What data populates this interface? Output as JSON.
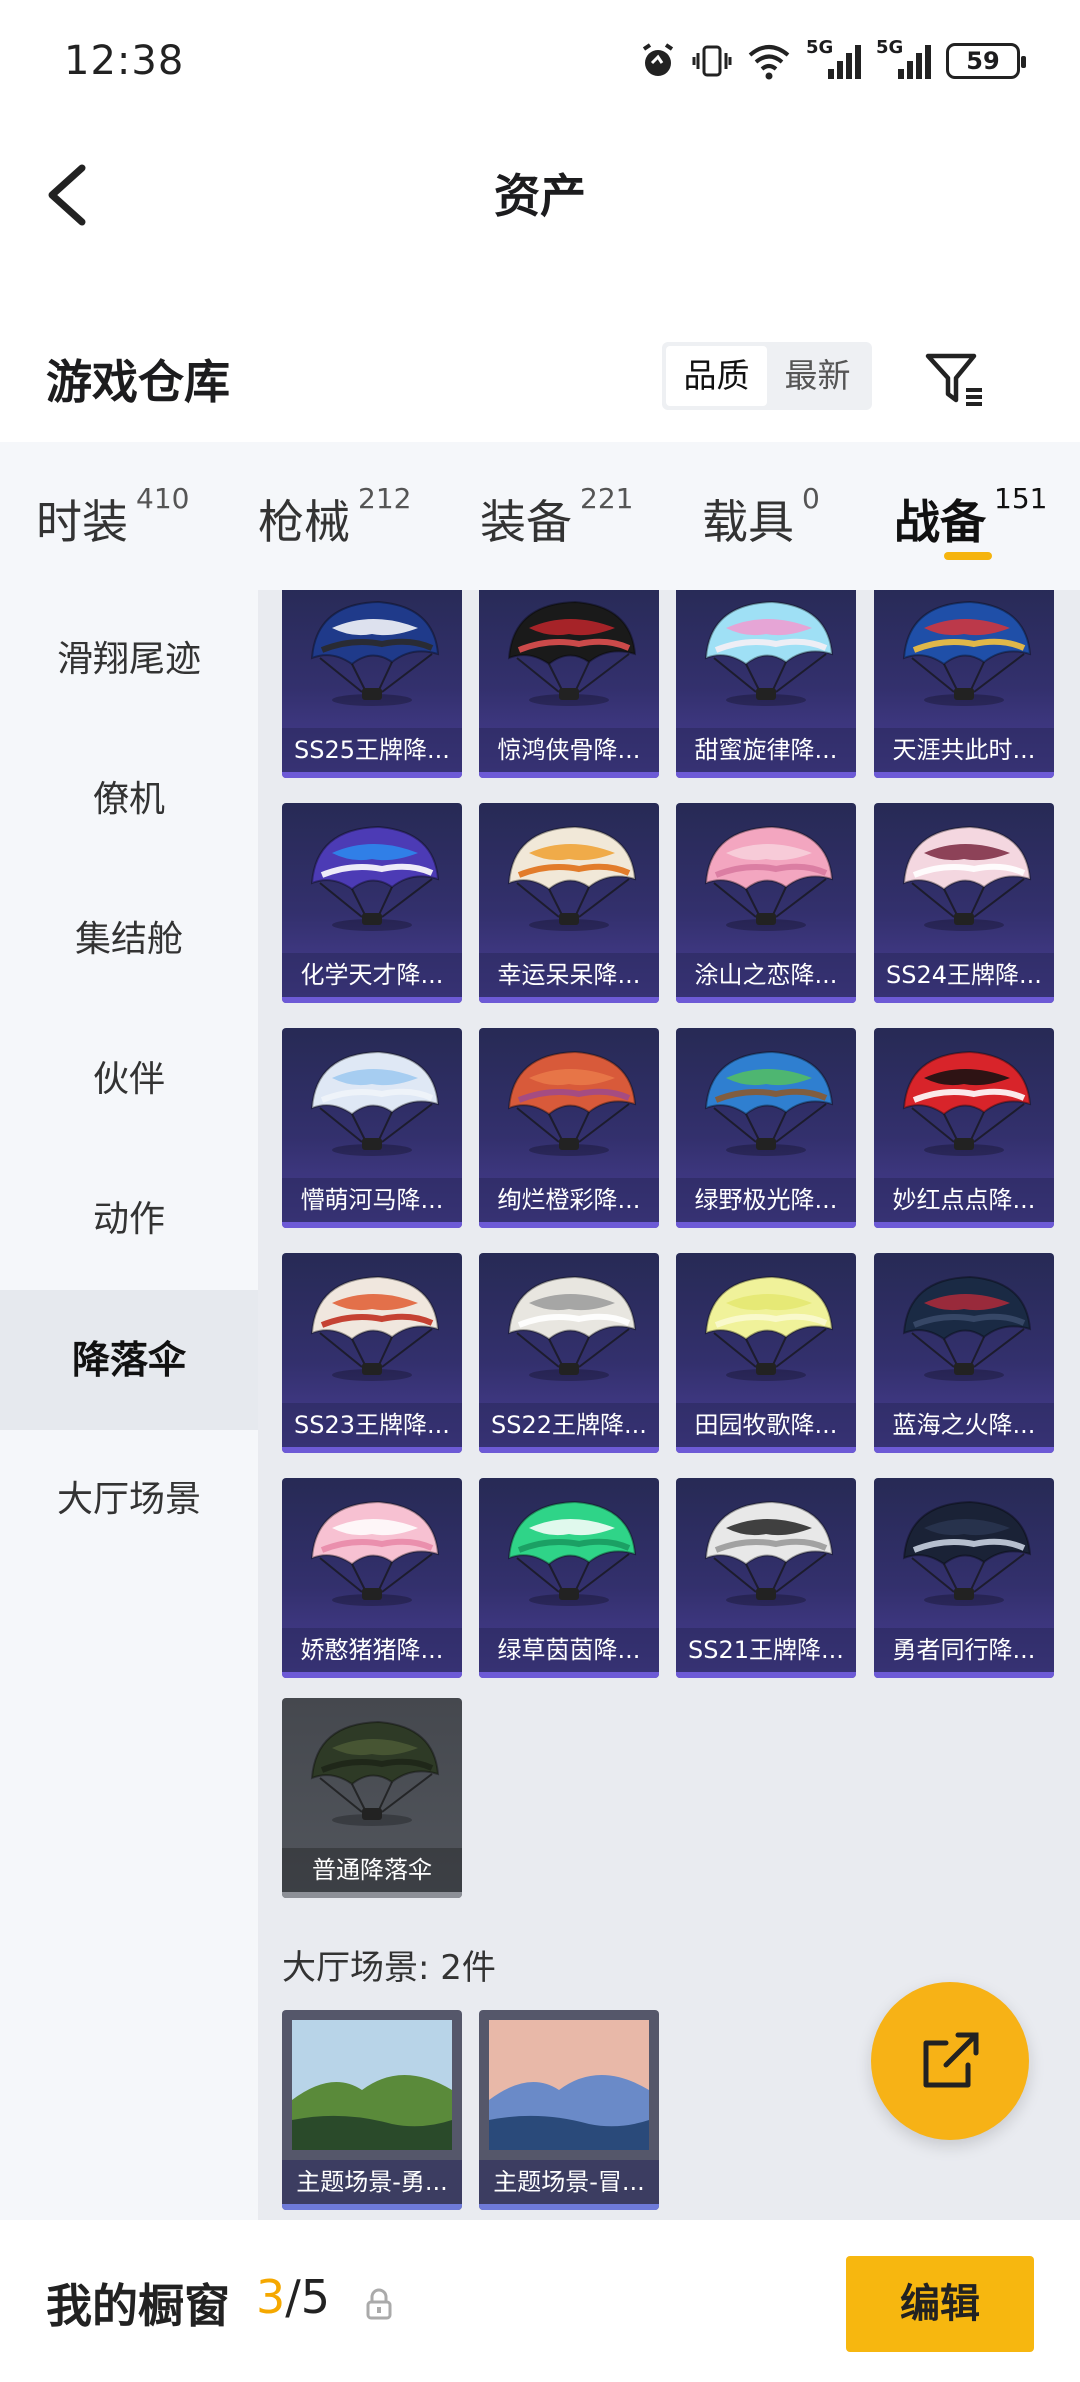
{
  "status_bar": {
    "time": "12:38",
    "battery": "59",
    "net1": "5G",
    "net2": "5G"
  },
  "header": {
    "title": "资产"
  },
  "warehouse": {
    "title": "游戏仓库",
    "sort_quality": "品质",
    "sort_newest": "最新"
  },
  "tabs": [
    {
      "label": "时装",
      "count": "410"
    },
    {
      "label": "枪械",
      "count": "212"
    },
    {
      "label": "装备",
      "count": "221"
    },
    {
      "label": "载具",
      "count": "0"
    },
    {
      "label": "战备",
      "count": "151",
      "active": true
    }
  ],
  "sidebar": [
    {
      "label": "滑翔尾迹"
    },
    {
      "label": "僚机"
    },
    {
      "label": "集结舱"
    },
    {
      "label": "伙伴"
    },
    {
      "label": "动作"
    },
    {
      "label": "降落伞",
      "active": true
    },
    {
      "label": "大厅场景"
    }
  ],
  "parachutes": [
    {
      "label": "SS25王牌降...",
      "colors": [
        "#1f3a8a",
        "#ffffff",
        "#2a2a2a"
      ]
    },
    {
      "label": "惊鸿侠骨降...",
      "colors": [
        "#1a1a1a",
        "#c0262b",
        "#e05050"
      ]
    },
    {
      "label": "甜蜜旋律降...",
      "colors": [
        "#9fe0f5",
        "#f29ad0",
        "#f5f0f5"
      ]
    },
    {
      "label": "天涯共此时...",
      "colors": [
        "#1f4fa8",
        "#d8353a",
        "#f5c23e"
      ]
    },
    {
      "label": "化学天才降...",
      "colors": [
        "#4c3bb5",
        "#2c8cf0",
        "#ffffff"
      ]
    },
    {
      "label": "幸运呆呆降...",
      "colors": [
        "#f1e8d8",
        "#f0a030",
        "#e07018"
      ]
    },
    {
      "label": "涂山之恋降...",
      "colors": [
        "#f3a6c0",
        "#f7d1dc",
        "#d87aa0"
      ]
    },
    {
      "label": "SS24王牌降...",
      "colors": [
        "#f4d7e0",
        "#7a2840",
        "#ffffff"
      ]
    },
    {
      "label": "懵萌河马降...",
      "colors": [
        "#dfe8f5",
        "#9cc8f0",
        "#f0f4fa"
      ]
    },
    {
      "label": "绚烂橙彩降...",
      "colors": [
        "#d85a3a",
        "#ea7a4a",
        "#a04a8a"
      ]
    },
    {
      "label": "绿野极光降...",
      "colors": [
        "#2f7fd0",
        "#54c060",
        "#8a5a30"
      ]
    },
    {
      "label": "妙红点点降...",
      "colors": [
        "#d8242a",
        "#111111",
        "#ffffff"
      ]
    },
    {
      "label": "SS23王牌降...",
      "colors": [
        "#f0e7de",
        "#e05a30",
        "#c03020"
      ]
    },
    {
      "label": "SS22王牌降...",
      "colors": [
        "#e8e6e0",
        "#9a9a9a",
        "#ffffff"
      ]
    },
    {
      "label": "田园牧歌降...",
      "colors": [
        "#f0f29a",
        "#e4e870",
        "#fafad0"
      ]
    },
    {
      "label": "蓝海之火降...",
      "colors": [
        "#1a2a44",
        "#b02a3a",
        "#3a4a6a"
      ]
    },
    {
      "label": "娇憨猪猪降...",
      "colors": [
        "#f7c1d2",
        "#ffffff",
        "#e88aa8"
      ]
    },
    {
      "label": "绿草茵茵降...",
      "colors": [
        "#2fd488",
        "#ffffff",
        "#1a9a60"
      ]
    },
    {
      "label": "SS21王牌降...",
      "colors": [
        "#e8e8e8",
        "#222222",
        "#9a9a9a"
      ]
    },
    {
      "label": "勇者同行降...",
      "colors": [
        "#1a2236",
        "#2a3550",
        "#c8d0e0"
      ]
    },
    {
      "label": "普通降落伞",
      "colors": [
        "#2e3a26",
        "#4b5a36",
        "#1e2618"
      ]
    }
  ],
  "lobby_section": {
    "title": "大厅场景: 2件"
  },
  "lobby_scenes": [
    {
      "label": "主题场景-勇...",
      "colors": [
        "#b8d4e8",
        "#5a8a3a",
        "#2a4a2a"
      ]
    },
    {
      "label": "主题场景-冒...",
      "colors": [
        "#e8b8a8",
        "#6a8ac8",
        "#2a4a7a"
      ]
    }
  ],
  "bottom": {
    "showcase_label": "我的橱窗",
    "current": "3",
    "total": "/5",
    "edit_label": "编辑"
  }
}
